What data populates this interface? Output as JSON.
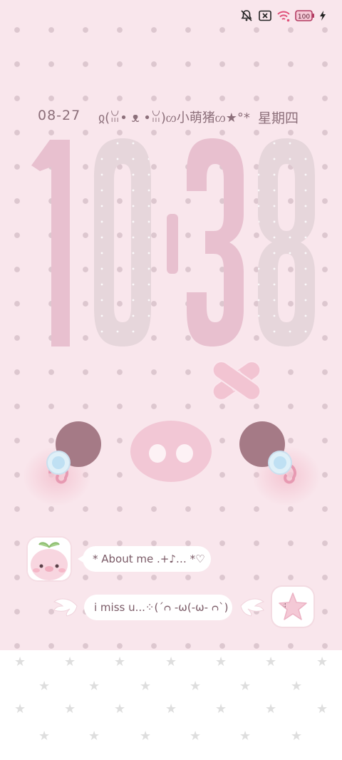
{
  "status_bar": {
    "icons": [
      "mute-icon",
      "sim-x-icon",
      "wifi-icon",
      "battery-icon",
      "charging-icon"
    ],
    "battery": "100"
  },
  "lockscreen": {
    "date": "08-27",
    "name": "ჲ(ꈍ• ᴥ •ꈍ)ᦠ小萌猪ᦠ★°*",
    "weekday": "星期四",
    "time_hours": "10",
    "time_minutes": "38"
  },
  "widgets": {
    "about_text": "* About me .+♪… *♡",
    "miss_text": "i miss u...⁘(´ᴒ -ω(-ω- ᴒ`)"
  },
  "colors": {
    "background": "#f9e6ec",
    "digit_pink": "#e8c0cf",
    "digit_grey": "#e6d6db",
    "text": "#8c6f7a"
  }
}
